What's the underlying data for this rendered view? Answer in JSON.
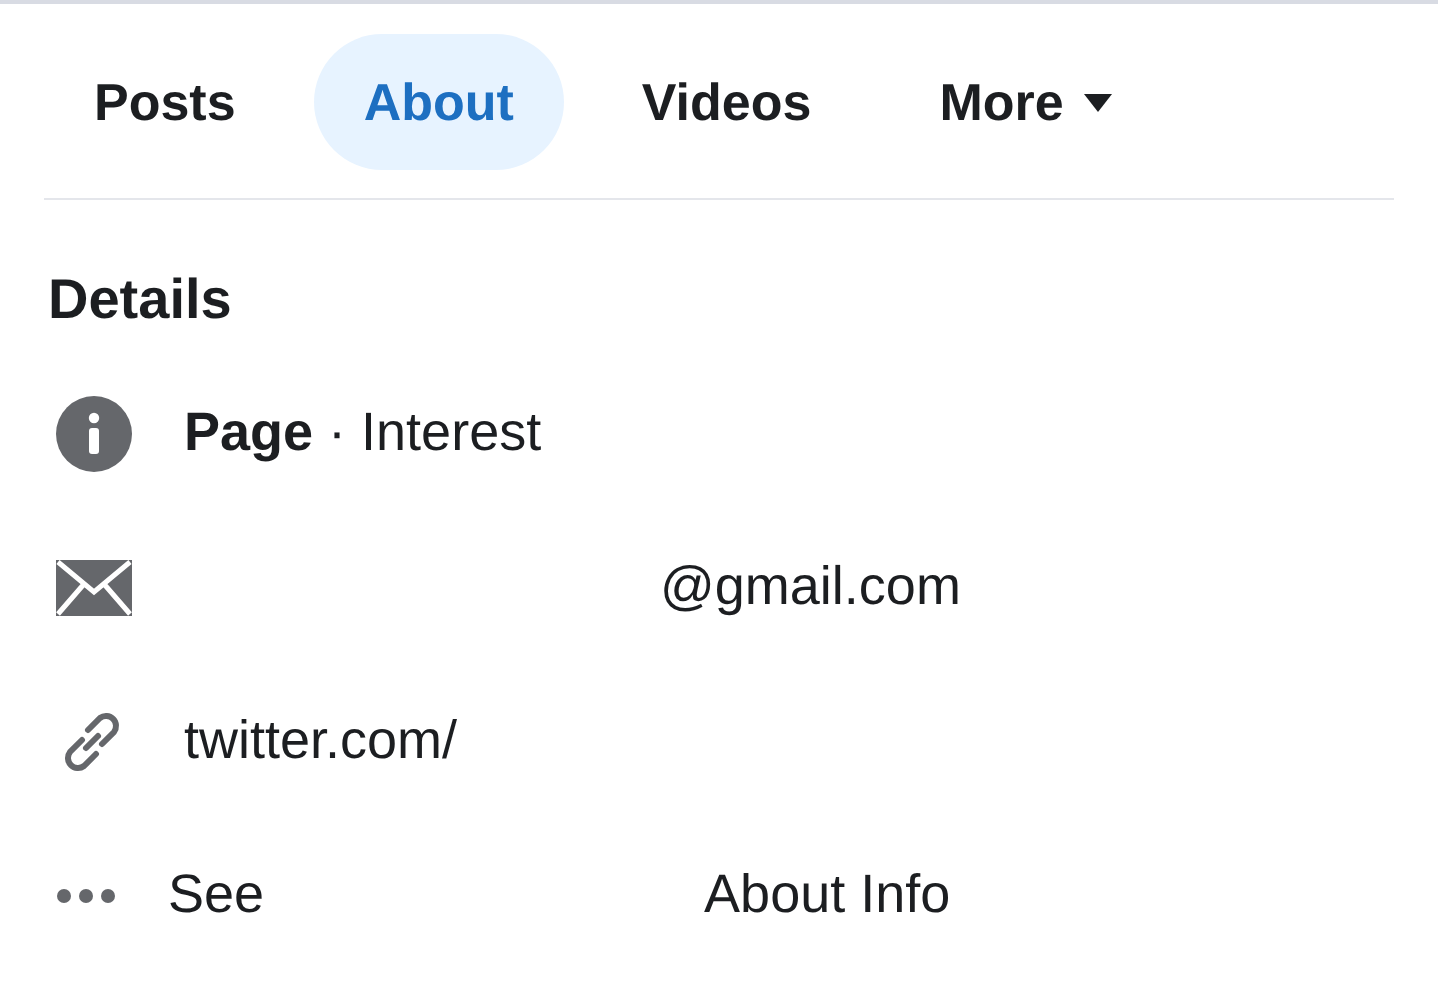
{
  "tabs": [
    {
      "label": "Posts",
      "selected": false,
      "dropdown": false
    },
    {
      "label": "About",
      "selected": true,
      "dropdown": false
    },
    {
      "label": "Videos",
      "selected": false,
      "dropdown": false
    },
    {
      "label": "More",
      "selected": false,
      "dropdown": true
    }
  ],
  "details": {
    "title": "Details",
    "rows": [
      {
        "kind": "info",
        "parts": [
          "**Page** · Interest"
        ]
      },
      {
        "kind": "email",
        "parts": [
          "@gmail.com"
        ],
        "gap_before": true
      },
      {
        "kind": "link",
        "parts": [
          "twitter.com/"
        ]
      },
      {
        "kind": "more",
        "parts": [
          "See",
          "About Info"
        ]
      }
    ]
  }
}
